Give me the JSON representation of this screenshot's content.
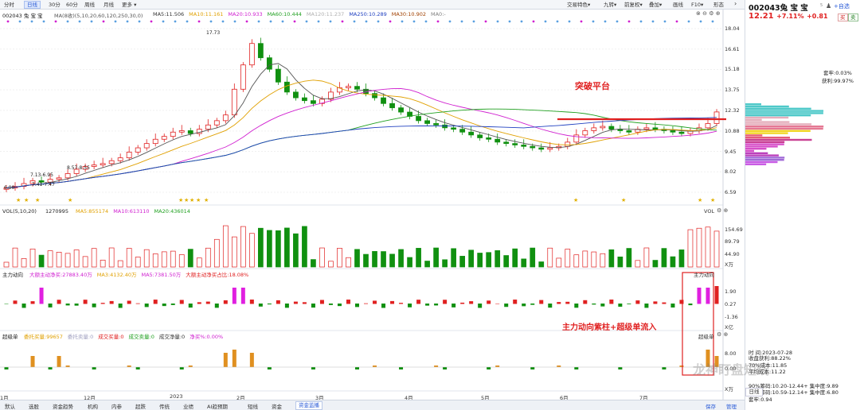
{
  "toolbar": {
    "left_items": [
      "分时",
      "日线",
      "30分",
      "60分",
      "周线",
      "月线",
      "更多"
    ],
    "active": "日线",
    "right_items": [
      "叠加",
      "画线",
      "F10",
      "形态"
    ],
    "right_dropdowns": [
      "交易特色",
      "九转",
      "前复权",
      "叠加"
    ],
    "gear_icon": "gear-icon"
  },
  "main_chart": {
    "stock_label": "002043 兔 宝 宝",
    "ma_label": "MA(8收)(5,10,20,60,120,250,30,0)",
    "ma_items": [
      {
        "text": "MA5:11.506",
        "color": "#333333"
      },
      {
        "text": "MA10:11.161",
        "color": "#e0a000"
      },
      {
        "text": "MA20:10.933",
        "color": "#d020d0"
      },
      {
        "text": "MA60:10.444",
        "color": "#20a020"
      },
      {
        "text": "MA120:11.237",
        "color": "#b0b0b0"
      },
      {
        "text": "MA250:10.289",
        "color": "#2040c0"
      },
      {
        "text": "MA30:10.902",
        "color": "#a04000"
      },
      {
        "text": "MA0:-",
        "color": "#808080"
      }
    ],
    "y_ticks": [
      "18.04",
      "16.61",
      "15.18",
      "13.75",
      "12.32",
      "10.88",
      "9.45",
      "8.02",
      "6.59"
    ],
    "high_label": "17.73",
    "low_label": "6.90",
    "price_labels": [
      "7.41-7.47",
      "7.13-6.95",
      "8.57-8.55"
    ],
    "annotation": "突破平台"
  },
  "volume": {
    "title": "VOL(5,10,20)",
    "value": "1270995",
    "ma_items": [
      {
        "text": "MA5:855174",
        "color": "#e0a000"
      },
      {
        "text": "MA10:613110",
        "color": "#d020d0"
      },
      {
        "text": "MA20:436014",
        "color": "#20a020"
      }
    ],
    "y_ticks": [
      "154.69",
      "89.79",
      "44.90"
    ],
    "unit": "X万",
    "right_label": "VOL"
  },
  "main_force": {
    "title": "主力动向",
    "items": [
      {
        "text": "大额主动净买:27883.40万",
        "color": "#d020d0"
      },
      {
        "text": "MA3:4132.40万",
        "color": "#e0a000"
      },
      {
        "text": "MA5:7381.50万",
        "color": "#d020d0"
      },
      {
        "text": "大额主动净买占比:18.08%",
        "color": "#e02020"
      }
    ],
    "y_ticks": [
      "1.90",
      "0.27",
      "-1.36"
    ],
    "unit": "X亿",
    "right_label": "主力动向",
    "annotation": "主力动向紫柱+超级单流入"
  },
  "super_order": {
    "title": "超级单",
    "items": [
      {
        "text": "委托买量:99657",
        "color": "#e0a000"
      },
      {
        "text": "委托卖量:0",
        "color": "#a0a0c0"
      },
      {
        "text": "成交买量:0",
        "color": "#e02020"
      },
      {
        "text": "成交卖量:0",
        "color": "#20a020"
      },
      {
        "text": "成交净量:0",
        "color": "#333333"
      },
      {
        "text": "净买%:0.00%",
        "color": "#d020d0"
      }
    ],
    "y_ticks": [
      "8.00",
      "0.00"
    ],
    "unit": "X万",
    "right_label": "超级单"
  },
  "x_axis": [
    "1月",
    "12月",
    "2023",
    "2月",
    "3月",
    "4月",
    "5月",
    "6月",
    "7月"
  ],
  "bottom_tabs": [
    "默认",
    "选股",
    "资金趋势",
    "机构",
    "内参",
    "超跌",
    "传统",
    "业绩",
    "AI趋预期",
    "短线",
    "资金",
    "资金监播"
  ],
  "bottom_active": "资金监播",
  "bottom_right": [
    "保存",
    "管理"
  ],
  "right_panel": {
    "code_name": "002043兔 宝 宝",
    "tag": "5",
    "watch_label": "+自选",
    "price": "12.21",
    "change_pct": "+7.11%",
    "change": "+0.81",
    "buy_label": "买",
    "sell_label": "卖",
    "profit_ratio_label": "获利:99.97%",
    "cost_label": "套牢:0.03%",
    "date_label": "时    间:2023-07-28",
    "stats": [
      "收盘获利:88.22%",
      "70%成本:11.85",
      "平均成本:11.22",
      "90%筹码:10.20-12.44+ 集中度:9.89",
      "70%筹码:10.59-12.14+ 集中度:6.80",
      "套牢:0.94"
    ],
    "daily_label": "日线"
  },
  "watermark": "龙神盯盘短线",
  "chart_data": {
    "type": "candlestick",
    "title": "002043 兔 宝 宝",
    "ylim": [
      6.59,
      18.04
    ],
    "x_ticks": [
      "1月",
      "12月",
      "2023",
      "2月",
      "3月",
      "4月",
      "5月",
      "6月",
      "7月"
    ],
    "closes": [
      6.9,
      7.0,
      7.2,
      7.4,
      7.3,
      7.5,
      7.6,
      7.9,
      8.2,
      8.4,
      8.5,
      8.6,
      8.8,
      9.0,
      9.4,
      9.7,
      10.0,
      10.3,
      10.5,
      10.8,
      10.9,
      10.7,
      11.0,
      11.3,
      11.6,
      12.0,
      13.8,
      15.5,
      17.0,
      16.0,
      15.2,
      14.3,
      13.6,
      13.2,
      13.0,
      12.8,
      13.1,
      13.6,
      13.9,
      14.0,
      13.8,
      13.5,
      13.2,
      12.8,
      12.5,
      12.2,
      11.9,
      11.6,
      11.4,
      11.3,
      11.1,
      11.0,
      10.8,
      10.6,
      10.4,
      10.3,
      10.1,
      10.0,
      9.9,
      9.8,
      9.7,
      9.6,
      9.7,
      9.8,
      10.1,
      10.6,
      10.9,
      11.1,
      11.2,
      11.0,
      10.9,
      10.8,
      11.0,
      11.1,
      11.0,
      10.9,
      10.8,
      10.7,
      10.9,
      11.1,
      11.4,
      12.21
    ],
    "volume_series": [
      {
        "name": "VOL",
        "unit": "X万",
        "ylim": [
          0,
          154.69
        ]
      }
    ]
  }
}
